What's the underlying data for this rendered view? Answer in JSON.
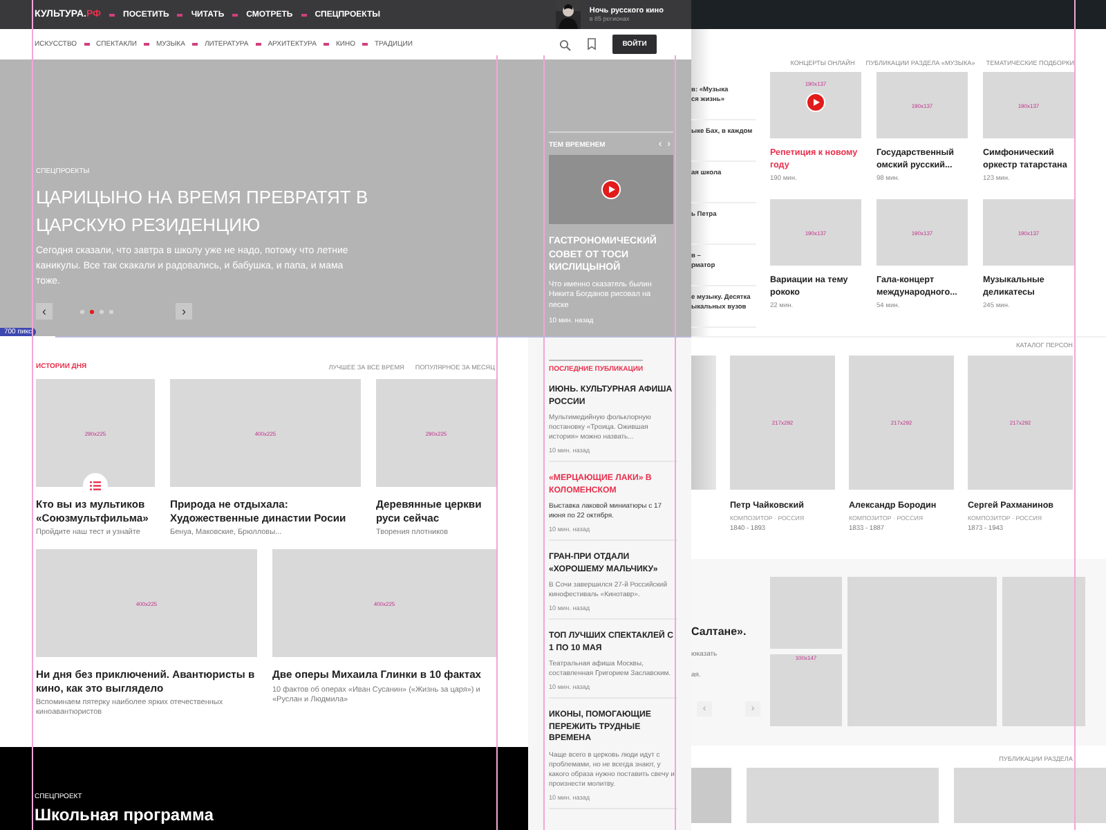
{
  "top_bar": {
    "logo": "КУЛЬТУРА.",
    "logo_accent": "РФ",
    "menu": [
      "ПОСЕТИТЬ",
      "ЧИТАТЬ",
      "СМОТРЕТЬ",
      "СПЕЦПРОЕКТЫ"
    ],
    "promo": {
      "kind": "picture",
      "title": "Ночь русского кино",
      "subtitle": "в 85 регионах"
    }
  },
  "nav": {
    "items": [
      "ИСКУССТВО",
      "СПЕКТАКЛИ",
      "МУЗЫКА",
      "ЛИТЕРАТУРА",
      "АРХИТЕКТУРА",
      "КИНО",
      "ТРАДИЦИИ"
    ],
    "login": "ВОЙТИ"
  },
  "hero": {
    "category": "СПЕЦПРОЕКТЫ",
    "title": "ЦАРИЦЫНО НА ВРЕМЯ ПРЕВРАТЯТ В ЦАРСКУЮ РЕЗИДЕНЦИЮ",
    "text": "Сегодня сказали, что завтра в школу уже не надо, потому что летние каникулы. Все так скакали и радовались, и бабушка, и папа, и мама тоже.",
    "prev": "‹",
    "next": "›",
    "dots": [
      {
        "selected": false
      },
      {
        "selected": true
      },
      {
        "selected": false
      },
      {
        "selected": false
      }
    ]
  },
  "meanwhile": {
    "heading": "ТЕМ ВРЕМЕНЕМ",
    "prev": "‹",
    "next": "›",
    "title": "ГАСТРОНОМИЧЕСКИЙ СОВЕТ ОТ ТОСИ КИСЛИЦЫНОЙ",
    "text": "Что именно сказатель былин Никита Богданов рисовал на песке",
    "time": "10 мин. назад"
  },
  "width_badge": "700 пикс",
  "stories": {
    "heading": "ИСТОРИИ ДНЯ",
    "tabs": [
      "ЛУЧШЕЕ ЗА ВСЕ ВРЕМЯ",
      "ПОПУЛЯРНОЕ ЗА МЕСЯЦ"
    ],
    "rows": [
      [
        {
          "kind": "test",
          "size": "290x225",
          "title": "Кто вы из мультиков «Союзмультфильма»",
          "text": "Пройдите наш тест и узнайте"
        },
        {
          "kind": "article",
          "size": "400x225",
          "title": "Природа не отдыхала: Художественные династии Росии",
          "text": "Бенуа, Маковские, Брюлловы..."
        },
        {
          "kind": "article",
          "size": "290x225",
          "title": "Деревянные церкви руси сейчас",
          "text": "Творения плотников"
        }
      ],
      [
        {
          "kind": "article",
          "size": "400x225",
          "title": "Ни дня без приключений. Авантюристы в кино, как это выглядело",
          "text": "Вспоминаем пятерку наиболее ярких отечественных киноавантюристов"
        },
        {
          "kind": "article",
          "size": "400x225",
          "title": "Две оперы Михаила Глинки в 10 фактах",
          "text": "10 фактов об операх «Иван Сусанин» («Жизнь за царя») и «Руслан и Людмила»"
        }
      ]
    ]
  },
  "special": {
    "label": "СПЕЦПРОЕКТ",
    "title": "Школьная программа"
  },
  "publications": {
    "heading": "ПОСЛЕДНИЕ ПУБЛИКАЦИИ",
    "items": [
      {
        "highlighted": false,
        "title": "ИЮНЬ. КУЛЬТУРНАЯ АФИША РОССИИ",
        "text": "Мультимедийную фольклорную постановку «Троица. Ожившая история» можно назвать...",
        "time": "10 мин. назад"
      },
      {
        "highlighted": true,
        "title": "«МЕРЦАЮЩИЕ ЛАКИ» В КОЛОМЕНСКОМ",
        "text": "Выставка лаковой миниатюры с 17 июня по 22 октября.",
        "time": "10 мин. назад"
      },
      {
        "highlighted": false,
        "title": "ГРАН-ПРИ ОТДАЛИ «ХОРОШЕМУ МАЛЬЧИКУ»",
        "text": "В Сочи завершился 27-й Российский кинофестиваль «Кинотавр».",
        "time": "10 мин. назад"
      },
      {
        "highlighted": false,
        "title": "ТОП ЛУЧШИХ СПЕКТАКЛЕЙ С 1 ПО 10 МАЯ",
        "text": "Театральная афиша Москвы, составленная Григорием Заславским.",
        "time": "10 мин. назад"
      },
      {
        "highlighted": false,
        "title": "ИКОНЫ, ПОМОГАЮЩИЕ ПЕРЕЖИТЬ ТРУДНЫЕ ВРЕМЕНА",
        "text": "Чаще всего в церковь люди идут с проблемами, но не всегда знают, у какого образа нужно поставить свечу и произнести молитву.",
        "time": "10 мин. назад"
      }
    ]
  },
  "music": {
    "tabs": [
      "КОНЦЕРТЫ ОНЛАЙН",
      "ПУБЛИКАЦИИ РАЗДЕЛА «МУЗЫКА»",
      "ТЕМАТИЧЕСКИЕ ПОДБОРКИ"
    ],
    "side_items": [
      [
        "в: «Музыка",
        "ся жизнь»"
      ],
      [
        "ыке Бах, в каждом"
      ],
      [
        "ая школа"
      ],
      [
        "ь Петра"
      ],
      [
        "в –",
        "рматор"
      ],
      [
        "е музыку. Десятка",
        "ыкальных вузов"
      ]
    ],
    "videos": [
      {
        "kind": "video",
        "highlighted": true,
        "size": "190x137",
        "title": "Репетиция к новому году",
        "duration": "190 мин."
      },
      {
        "kind": "plain",
        "highlighted": false,
        "size": "190x137",
        "title": "Государственный омский русский...",
        "duration": "98 мин."
      },
      {
        "kind": "plain",
        "highlighted": false,
        "size": "190x137",
        "title": "Симфонический оркестр татарстана",
        "duration": "123 мин."
      },
      {
        "kind": "plain",
        "highlighted": false,
        "size": "190x137",
        "title": "Вариации на тему рококо",
        "duration": "22 мин."
      },
      {
        "kind": "plain",
        "highlighted": false,
        "size": "190x137",
        "title": "Гала-концерт международного...",
        "duration": "54 мин."
      },
      {
        "kind": "plain",
        "highlighted": false,
        "size": "190x137",
        "title": "Музыкальные деликатесы",
        "duration": "245 мин."
      }
    ]
  },
  "persons": {
    "heading": "КАТАЛОГ ПЕРСОН",
    "items": [
      {
        "size": "217x292",
        "name": "Петр Чайковский",
        "role": "КОМПОЗИТОР · РОССИЯ",
        "years": "1840 - 1893"
      },
      {
        "size": "217x292",
        "name": "Александр Бородин",
        "role": "КОМПОЗИТОР · РОССИЯ",
        "years": "1833 - 1887"
      },
      {
        "size": "217x292",
        "name": "Сергей Рахманинов",
        "role": "КОМПОЗИТОР · РОССИЯ",
        "years": "1873 - 1943"
      }
    ]
  },
  "gallery": {
    "title": "Салтане».",
    "lines": [
      "юказать",
      "ая."
    ],
    "prev": "‹",
    "next": "›",
    "size": "100x147"
  },
  "section_publications": {
    "heading": "ПУБЛИКАЦИИ РАЗДЕЛА"
  }
}
